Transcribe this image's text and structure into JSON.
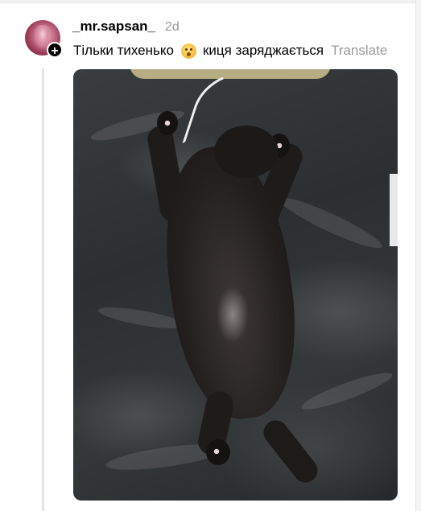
{
  "post": {
    "author": {
      "username": "_mr.sapsan_",
      "avatar_alt": "avatar"
    },
    "timestamp": "2d",
    "text_before_emoji": "Тільки тихенько",
    "emoji": "shushing-face",
    "text_after_emoji": "киця заряджається",
    "translate_label": "Translate",
    "follow_badge_symbol": "+",
    "photo_alt": "black cat sleeping on its back on a dark sheet with a charging cable"
  },
  "colors": {
    "text": "#000000",
    "muted": "#999999",
    "badge": "#000000",
    "thread_line": "#e5e5e5"
  }
}
